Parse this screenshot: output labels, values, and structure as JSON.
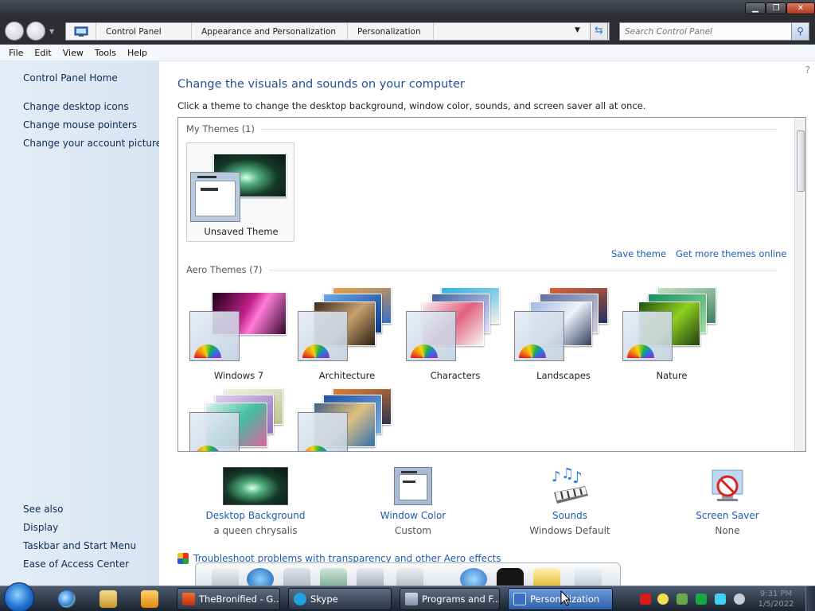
{
  "window": {
    "min_glyph": "▁",
    "max_glyph": "❐",
    "close_glyph": "✕"
  },
  "address": {
    "crumbs": [
      "Control Panel",
      "Appearance and Personalization",
      "Personalization"
    ],
    "search_placeholder": "Search Control Panel"
  },
  "menu": [
    "File",
    "Edit",
    "View",
    "Tools",
    "Help"
  ],
  "sidebar": {
    "home": "Control Panel Home",
    "links": [
      "Change desktop icons",
      "Change mouse pointers",
      "Change your account picture"
    ],
    "see_also_title": "See also",
    "see_also": [
      "Display",
      "Taskbar and Start Menu",
      "Ease of Access Center"
    ]
  },
  "main": {
    "title": "Change the visuals and sounds on your computer",
    "description": "Click a theme to change the desktop background, window color, sounds, and screen saver all at once.",
    "my_themes_header": "My Themes (1)",
    "unsaved_theme": "Unsaved Theme",
    "save_theme": "Save theme",
    "get_more_themes": "Get more themes online",
    "aero_header": "Aero Themes (7)",
    "aero_themes": [
      "Windows 7",
      "Architecture",
      "Characters",
      "Landscapes",
      "Nature"
    ],
    "bottom": [
      {
        "label": "Desktop Background",
        "sub": "a queen chrysalis"
      },
      {
        "label": "Window Color",
        "sub": "Custom"
      },
      {
        "label": "Sounds",
        "sub": "Windows Default"
      },
      {
        "label": "Screen Saver",
        "sub": "None"
      }
    ],
    "troubleshoot": "Troubleshoot problems with transparency and other Aero effects"
  },
  "taskbar": {
    "tasks": [
      "TheBronified - G...",
      "Skype",
      "Programs and F...",
      "Personalization"
    ],
    "time": "9:31 PM",
    "date": "1/5/2022"
  },
  "colors": {
    "link": "#1c5bb4",
    "title": "#1f4f9a",
    "taskbar": "#1b2330"
  }
}
